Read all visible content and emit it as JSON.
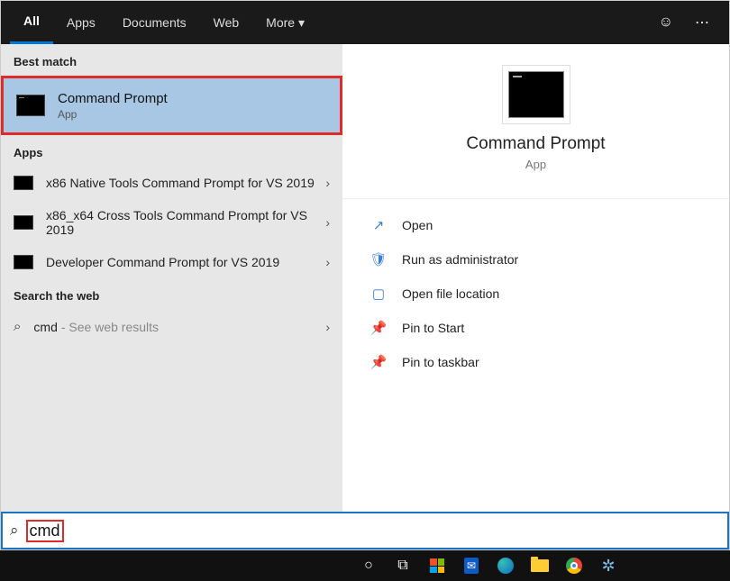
{
  "tabs": {
    "all": "All",
    "apps": "Apps",
    "documents": "Documents",
    "web": "Web",
    "more": "More ▾"
  },
  "sections": {
    "best": "Best match",
    "apps": "Apps",
    "web": "Search the web"
  },
  "best": {
    "title": "Command Prompt",
    "sub": "App"
  },
  "apps_list": [
    {
      "label": "x86 Native Tools Command Prompt for VS 2019"
    },
    {
      "label": "x86_x64 Cross Tools Command Prompt for VS 2019"
    },
    {
      "label": "Developer Command Prompt for VS 2019"
    }
  ],
  "web_row": {
    "query": "cmd",
    "hint": " - See web results"
  },
  "preview": {
    "title": "Command Prompt",
    "sub": "App"
  },
  "actions": [
    {
      "icon": "↗",
      "label": "Open"
    },
    {
      "icon": "🛡",
      "label": "Run as administrator"
    },
    {
      "icon": "▢",
      "label": "Open file location"
    },
    {
      "icon": "📌",
      "label": "Pin to Start"
    },
    {
      "icon": "📌",
      "label": "Pin to taskbar"
    }
  ],
  "search_value": "cmd"
}
